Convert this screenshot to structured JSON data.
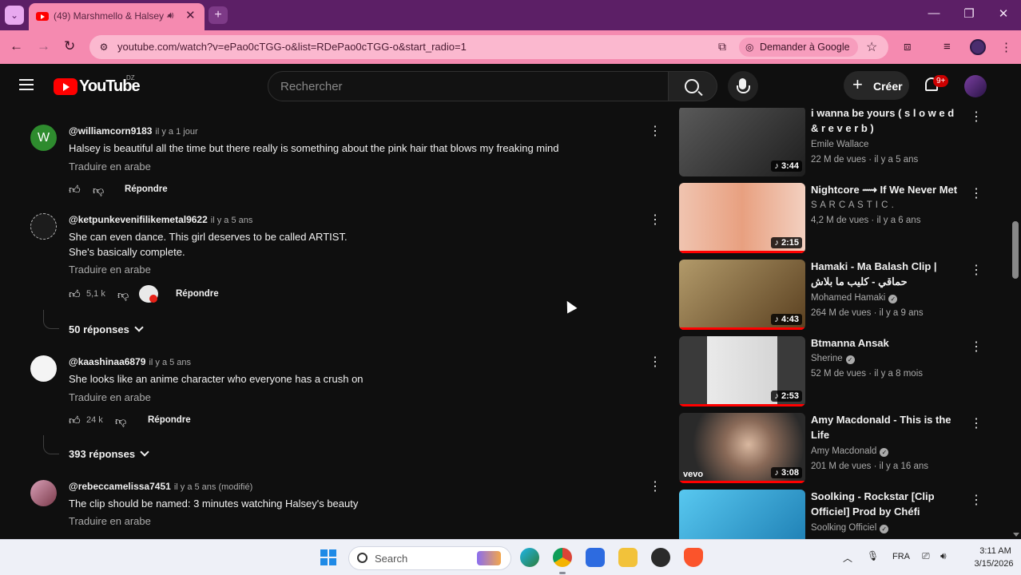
{
  "browser": {
    "tab_title": "(49) Marshmello & Halsey -",
    "url": "youtube.com/watch?v=ePao0cTGG-o&list=RDePao0cTGG-o&start_radio=1",
    "ask_google_label": "Demander à Google"
  },
  "youtube": {
    "wordmark": "YouTube",
    "country_code": "DZ",
    "search_placeholder": "Rechercher",
    "create_label": "Créer",
    "notifications_badge": "9+"
  },
  "comments": [
    {
      "handle": "@williamcorn9183",
      "time": "il y a 1 jour",
      "text_lines": [
        "Halsey is beautiful all the time but there really is something about the pink hair that blows my freaking mind"
      ],
      "translate": "Traduire en arabe",
      "likes": "",
      "reply": "Répondre",
      "avatar_letter": "W",
      "avatar_color": "#2e8b2e"
    },
    {
      "handle": "@ketpunkevenifilikemetal9622",
      "time": "il y a 5 ans",
      "text_lines": [
        "She can even dance. This girl deserves to be called  ARTIST.",
        "She's basically complete."
      ],
      "translate": "Traduire en arabe",
      "likes": "5,1 k",
      "reply": "Répondre",
      "replies": "50 réponses"
    },
    {
      "handle": "@kaashinaa6879",
      "time": "il y a 5 ans",
      "text_lines": [
        "She looks like an anime character who everyone has a crush on"
      ],
      "translate": "Traduire en arabe",
      "likes": "24 k",
      "reply": "Répondre",
      "replies": "393 réponses"
    },
    {
      "handle": "@rebeccamelissa7451",
      "time": "il y a 5 ans (modifié)",
      "text_lines": [
        "The clip should be named: 3 minutes watching Halsey's beauty"
      ],
      "translate": "Traduire en arabe"
    }
  ],
  "videos": [
    {
      "title": "i wanna be yours ( s l o w e d & r e v e r b )",
      "channel": "Emile Wallace",
      "verified": false,
      "views": "22 M de vues",
      "age": "il y a 5 ans",
      "duration": "3:44",
      "thumb_color": "#3a3a3a"
    },
    {
      "title": "Nightcore ⟿ If We Never Met",
      "channel": "S A R C A S T I C .",
      "verified": false,
      "views": "4,2 M de vues",
      "age": "il y a 6 ans",
      "duration": "2:15",
      "thumb_color": "#e7a98f"
    },
    {
      "title": "Hamaki - Ma Balash Clip | حماقي - كليب ما بلاش",
      "channel": "Mohamed Hamaki",
      "verified": true,
      "views": "264 M de vues",
      "age": "il y a 9 ans",
      "duration": "4:43",
      "thumb_color": "#8a6a3a"
    },
    {
      "title": "Btmanna Ansak",
      "channel": "Sherine",
      "verified": true,
      "views": "52 M de vues",
      "age": "il y a 8 mois",
      "duration": "2:53",
      "thumb_color": "#d8d8d8"
    },
    {
      "title": "Amy Macdonald - This is the Life",
      "channel": "Amy Macdonald",
      "verified": true,
      "views": "201 M de vues",
      "age": "il y a 16 ans",
      "duration": "3:08",
      "thumb_color": "#5a4a40"
    },
    {
      "title": "Soolking - Rockstar [Clip Officiel] Prod by Chéfi",
      "channel": "Soolking Officiel",
      "verified": true,
      "views": "",
      "age": "",
      "duration": "",
      "thumb_color": "#2aa6d8"
    }
  ],
  "taskbar": {
    "search_label": "Search",
    "language": "FRA",
    "time": "3:11 AM",
    "date": "3/15/2026"
  }
}
